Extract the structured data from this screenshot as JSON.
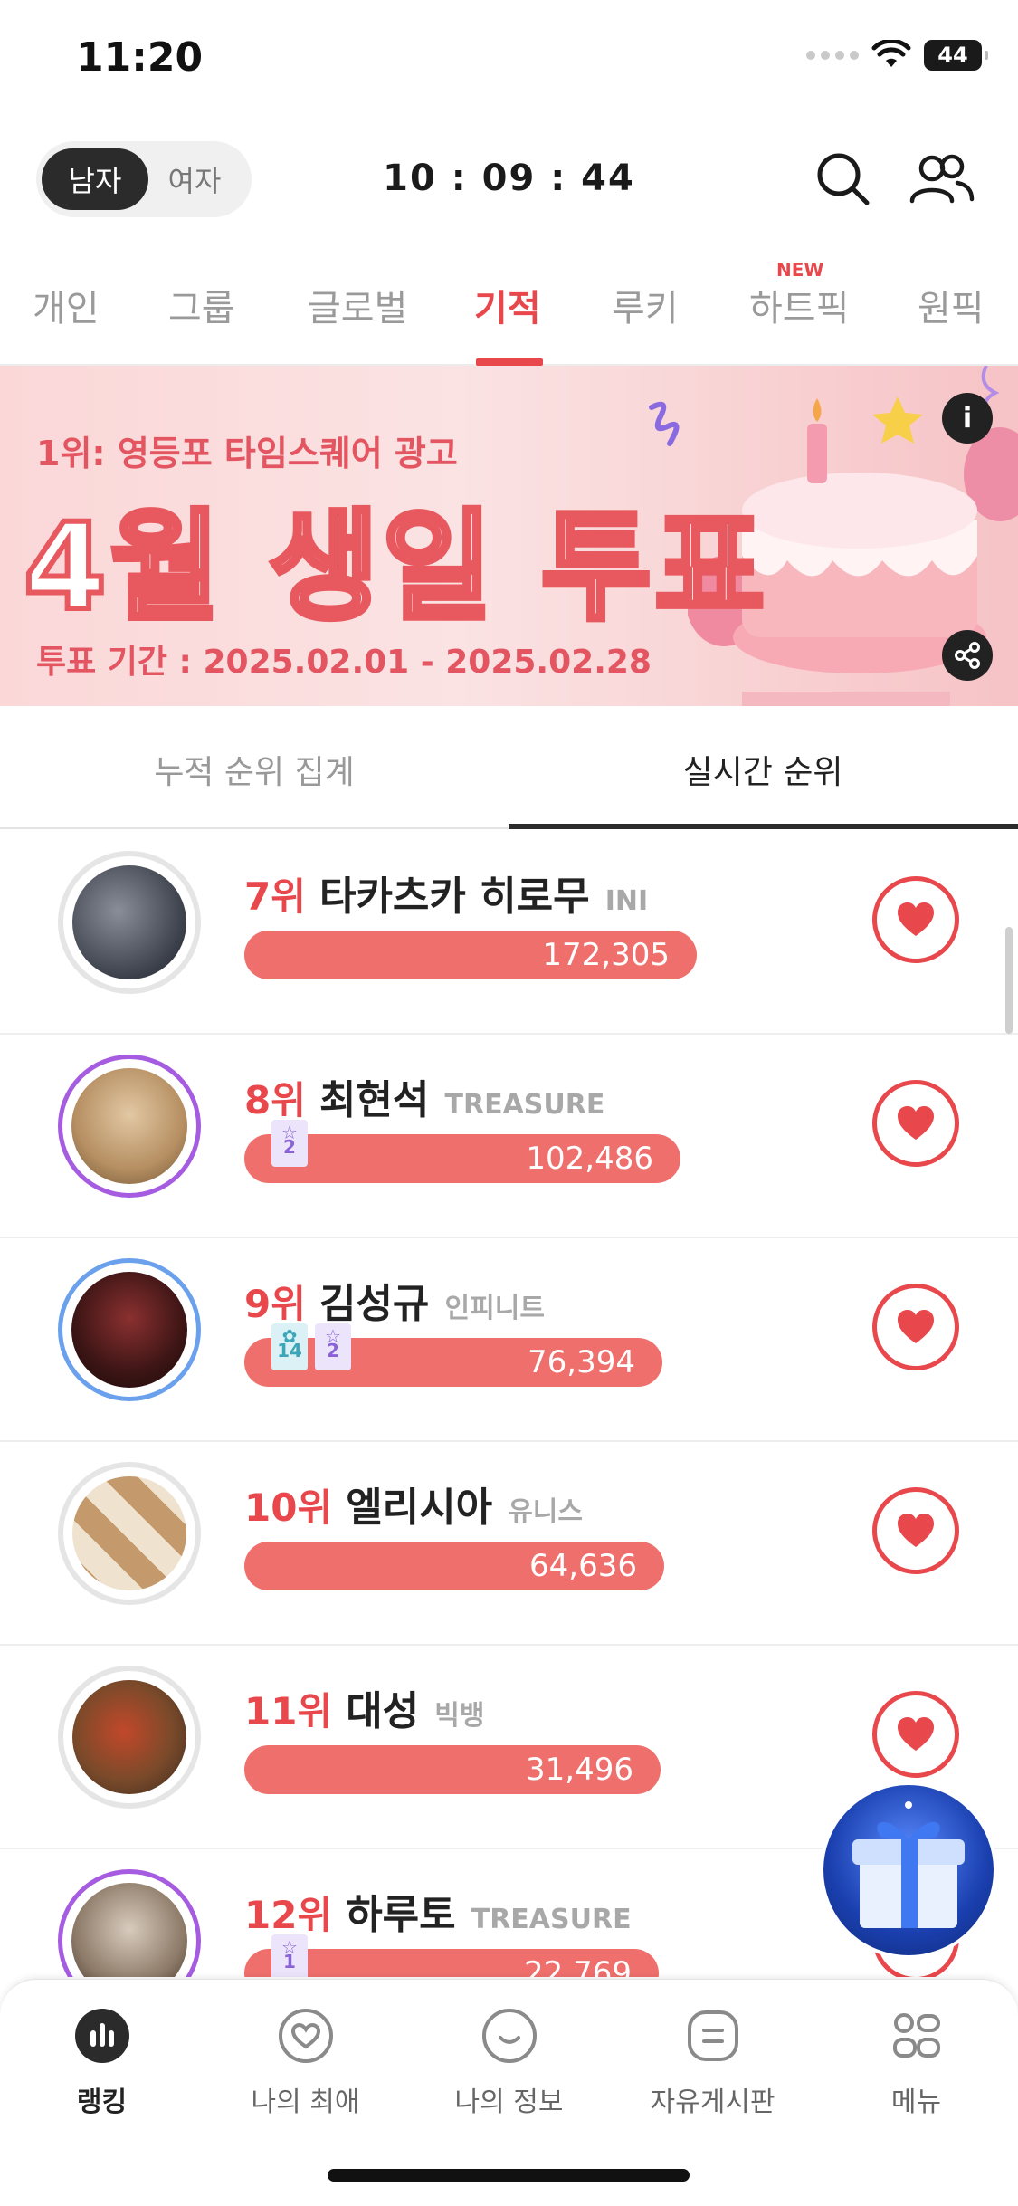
{
  "status_bar": {
    "time": "11:20",
    "battery": "44"
  },
  "header": {
    "gender_toggle": {
      "selected": "남자",
      "other": "여자"
    },
    "countdown": "10 : 09 : 44",
    "icons": [
      "search-icon",
      "users-icon"
    ]
  },
  "category_tabs": {
    "items": [
      "개인",
      "그룹",
      "글로벌",
      "기적",
      "루키",
      "하트픽",
      "원픽"
    ],
    "active": "기적",
    "new_badge": "NEW"
  },
  "banner": {
    "subtitle": "1위: 영등포 타임스퀘어 광고",
    "title": "4월 생일 투표",
    "period": "투표 기간 : 2025.02.01 - 2025.02.28",
    "info_label": "i",
    "share_icon": "share-icon"
  },
  "sub_tabs": {
    "items": [
      "누적 순위 집계",
      "실시간 순위"
    ],
    "active": "실시간 순위"
  },
  "ranking": [
    {
      "rank": "7위",
      "name": "타카츠카 히로무",
      "group": "INI",
      "votes": "172,305"
    },
    {
      "rank": "8위",
      "name": "최현석",
      "group": "TREASURE",
      "votes": "102,486",
      "badges": [
        "2"
      ]
    },
    {
      "rank": "9위",
      "name": "김성규",
      "group": "인피니트",
      "votes": "76,394",
      "badges": [
        "14",
        "2"
      ]
    },
    {
      "rank": "10위",
      "name": "엘리시아",
      "group": "유니스",
      "votes": "64,636"
    },
    {
      "rank": "11위",
      "name": "대성",
      "group": "빅뱅",
      "votes": "31,496"
    },
    {
      "rank": "12위",
      "name": "하루토",
      "group": "TREASURE",
      "votes": "22,769",
      "badges": [
        "1"
      ]
    }
  ],
  "colors": {
    "accent": "#e8474b",
    "bar": "#ef6f6c"
  },
  "bottom_nav": {
    "items": [
      "랭킹",
      "나의 최애",
      "나의 정보",
      "자유게시판",
      "메뉴"
    ],
    "active": "랭킹"
  }
}
